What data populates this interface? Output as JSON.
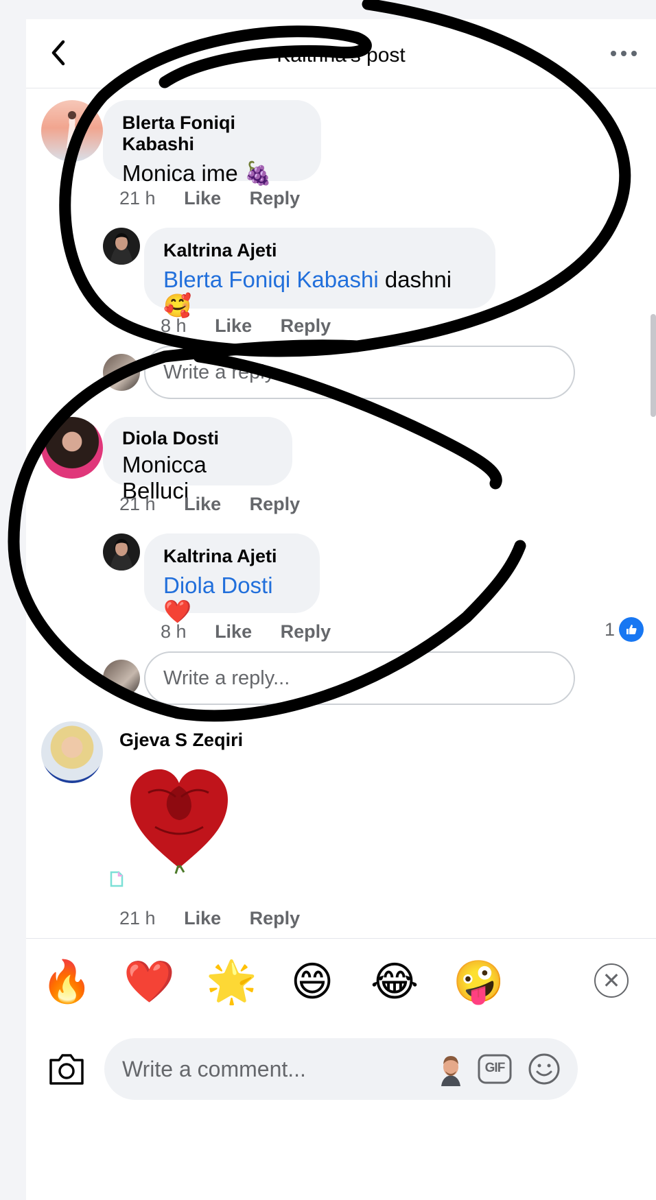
{
  "header": {
    "title": "Kaltrina's post"
  },
  "comments": [
    {
      "author": "Blerta Foniqi Kabashi",
      "text": "Monica ime 🍇",
      "time": "21 h",
      "like": "Like",
      "reply": "Reply",
      "replies": [
        {
          "author": "Kaltrina Ajeti",
          "mention": "Blerta Foniqi Kabashi",
          "text": " dashni 🥰",
          "time": "8 h",
          "like": "Like",
          "reply": "Reply"
        }
      ],
      "reply_placeholder": "Write a reply..."
    },
    {
      "author": "Diola Dosti",
      "text": "Monicca Belluci",
      "time": "21 h",
      "like": "Like",
      "reply": "Reply",
      "replies": [
        {
          "author": "Kaltrina Ajeti",
          "mention": "Diola Dosti",
          "text": " ❤️",
          "time": "8 h",
          "like": "Like",
          "reply": "Reply",
          "like_count": "1"
        }
      ],
      "reply_placeholder": "Write a reply..."
    },
    {
      "author": "Gjeva S Zeqiri",
      "sticker": "rose-heart-sticker",
      "time": "21 h",
      "like": "Like",
      "reply": "Reply"
    }
  ],
  "reactions": [
    "🔥",
    "❤️",
    "🌟",
    "😄",
    "😂",
    "🤪"
  ],
  "composer": {
    "placeholder": "Write a comment...",
    "gif_label": "GIF"
  },
  "colors": {
    "mention": "#216fdb",
    "like_blue": "#1877f2",
    "bubble": "#f0f2f5",
    "ink": "#000000"
  }
}
